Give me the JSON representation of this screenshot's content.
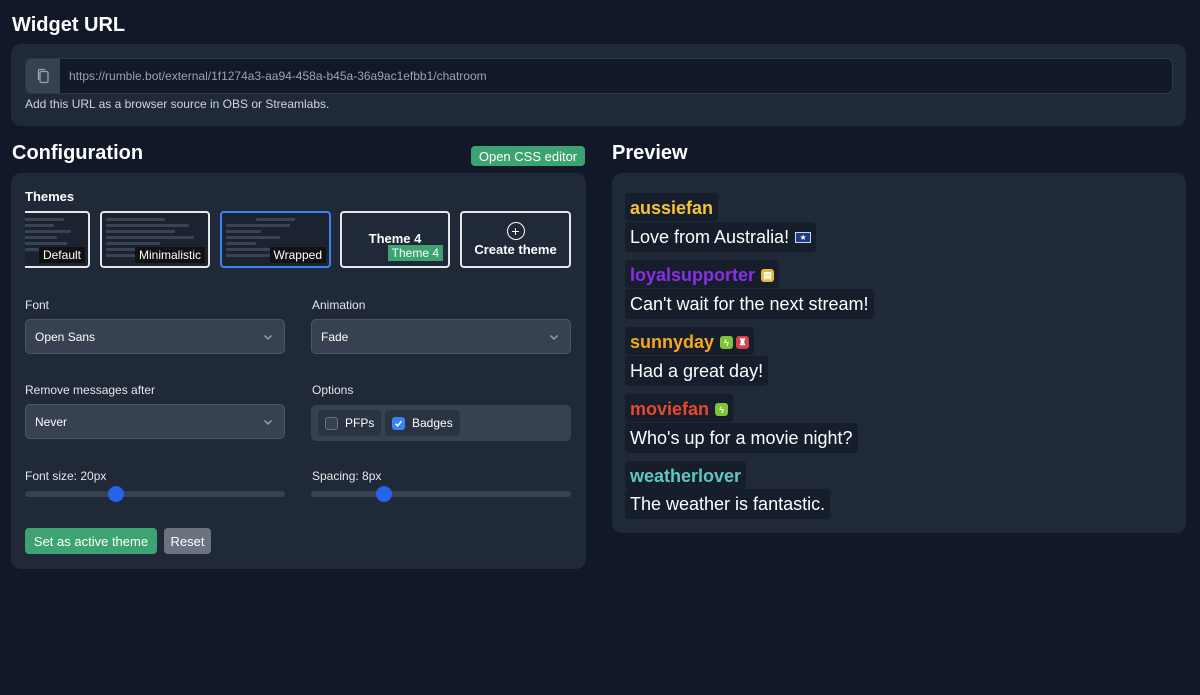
{
  "widget": {
    "title": "Widget URL",
    "url": "https://rumble.bot/external/1f1274a3-aa94-458a-b45a-36a9ac1efbb1/chatroom",
    "help": "Add this URL as a browser source in OBS or Streamlabs."
  },
  "config": {
    "title": "Configuration",
    "css_editor_label": "Open CSS editor",
    "themes_label": "Themes",
    "themes": [
      {
        "label": "Default"
      },
      {
        "label": "Minimalistic"
      },
      {
        "label": "Wrapped",
        "active": true
      },
      {
        "label": "Theme 4",
        "tag": "Theme 4"
      },
      {
        "label": "Create theme"
      }
    ],
    "font_label": "Font",
    "font_value": "Open Sans",
    "animation_label": "Animation",
    "animation_value": "Fade",
    "remove_label": "Remove messages after",
    "remove_value": "Never",
    "options_label": "Options",
    "options": [
      {
        "label": "PFPs",
        "checked": false
      },
      {
        "label": "Badges",
        "checked": true
      }
    ],
    "font_size_label": "Font size: 20px",
    "font_size_level": 0.35,
    "spacing_label": "Spacing: 8px",
    "spacing_level": 0.28,
    "set_active_label": "Set as active theme",
    "reset_label": "Reset"
  },
  "preview": {
    "title": "Preview",
    "messages": [
      {
        "user": "aussiefan",
        "color": "#f5c33b",
        "text": "Love from Australia!",
        "badges": [],
        "flag": "australia-flag"
      },
      {
        "user": "loyalsupporter",
        "color": "#8b2ee8",
        "text": "Can't wait for the next stream!",
        "badges": [
          "gold"
        ]
      },
      {
        "user": "sunnyday",
        "color": "#f5a623",
        "text": "Had a great day!",
        "badges": [
          "green",
          "red"
        ]
      },
      {
        "user": "moviefan",
        "color": "#e8472e",
        "text": "Who's up for a movie night?",
        "badges": [
          "green"
        ]
      },
      {
        "user": "weatherlover",
        "color": "#5ec8c0",
        "text": "The weather is fantastic.",
        "badges": []
      }
    ]
  },
  "colors": {
    "accent_green": "#3ea372",
    "accent_blue": "#2563eb",
    "badge_green": "#7cc53b",
    "badge_red": "#d9404a",
    "badge_gold": "#e5b73b"
  }
}
